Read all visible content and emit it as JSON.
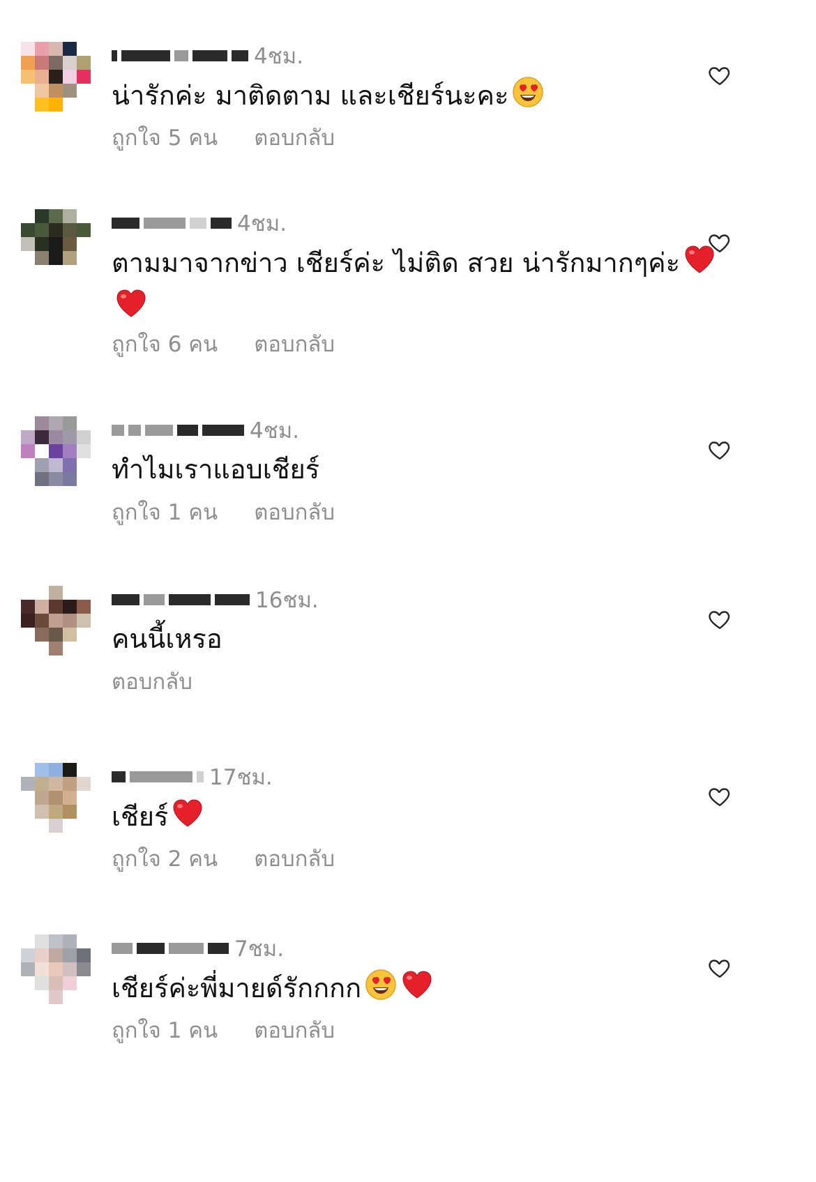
{
  "comments": [
    {
      "username": "",
      "time": "4ชม.",
      "text": "น่ารักค่ะ มาติดตาม และเชียร์นะคะ",
      "emojis": [
        "heart-eyes-emoji"
      ],
      "likes": "ถูกใจ 5 คน",
      "reply": "ตอบกลับ",
      "avatar_colors": [
        "#f6e3ea",
        "#e9a0a8",
        "#d7b8b0",
        "#1b2a44",
        "#ffffff",
        "#f0a050",
        "#c87a78",
        "#7e6a64",
        "#d7d0cc",
        "#b0a070",
        "#f5c070",
        "#e8b090",
        "#2a1f1a",
        "#f0d0e0",
        "#e83060",
        "#ffffff",
        "#f0c8a0",
        "#c09060",
        "#a09080",
        "#ffffff",
        "#ffffff",
        "#ffc020",
        "#ffb000",
        "#ffffff",
        "#ffffff"
      ]
    },
    {
      "username": "",
      "time": "4ชม.",
      "text": "ตามมาจากข่าว เชียร์ค่ะ ไม่ติด สวย น่ารักมากๆค่ะ",
      "emojis": [
        "red-heart-emoji",
        "red-heart-emoji"
      ],
      "likes": "ถูกใจ 6 คน",
      "reply": "ตอบกลับ",
      "avatar_colors": [
        "#ffffff",
        "#2a3a2a",
        "#5a6a4a",
        "#b0b0a0",
        "#ffffff",
        "#3a4a30",
        "#4a5a3a",
        "#2a2a20",
        "#5a5a40",
        "#4a5a3a",
        "#c0c0b8",
        "#2a3020",
        "#1a1a18",
        "#6a5a40",
        "#ffffff",
        "#ffffff",
        "#8a8070",
        "#1a1a18",
        "#b0a080",
        "#ffffff",
        "#ffffff",
        "#ffffff",
        "#ffffff",
        "#ffffff",
        "#ffffff"
      ]
    },
    {
      "username": "",
      "time": "4ชม.",
      "text": "ทำไมเราแอบเชียร์",
      "emojis": [],
      "likes": "ถูกใจ 1 คน",
      "reply": "ตอบกลับ",
      "avatar_colors": [
        "#ffffff",
        "#9a8a9a",
        "#b0a8b0",
        "#9a9a9a",
        "#ffffff",
        "#c0a8c8",
        "#3a2a3a",
        "#9a8aa0",
        "#a09aa8",
        "#d0d0d0",
        "#c080c0",
        "#ffffff",
        "#6a40a0",
        "#a080c0",
        "#e0e0e0",
        "#ffffff",
        "#a0a0b0",
        "#c0b8d0",
        "#8070b0",
        "#ffffff",
        "#ffffff",
        "#707080",
        "#8a8aa0",
        "#7a7aa0",
        "#ffffff"
      ]
    },
    {
      "username": "",
      "time": "16ชม.",
      "text": "คนนี้เหรอ",
      "emojis": [],
      "likes": "",
      "reply": "ตอบกลับ",
      "avatar_colors": [
        "#ffffff",
        "#ffffff",
        "#c0b0a0",
        "#ffffff",
        "#ffffff",
        "#4a2a2a",
        "#d0b0a0",
        "#5a3a30",
        "#2a1a18",
        "#8a5a4a",
        "#3a2020",
        "#6a4a3a",
        "#c0a090",
        "#b09080",
        "#d0c0b0",
        "#ffffff",
        "#8a6a5a",
        "#6a5a4a",
        "#d0c0a0",
        "#ffffff",
        "#ffffff",
        "#ffffff",
        "#a08070",
        "#ffffff",
        "#ffffff"
      ]
    },
    {
      "username": "",
      "time": "17ชม.",
      "text": "เชียร์",
      "emojis": [
        "red-heart-emoji"
      ],
      "likes": "ถูกใจ 2 คน",
      "reply": "ตอบกลับ",
      "avatar_colors": [
        "#ffffff",
        "#a0c0e8",
        "#90b0e0",
        "#1a1a18",
        "#ffffff",
        "#b0b0b8",
        "#c0b090",
        "#d0b8a0",
        "#c0a080",
        "#e0d8d0",
        "#ffffff",
        "#c0a890",
        "#b09070",
        "#d0b090",
        "#ffffff",
        "#ffffff",
        "#d0c0b0",
        "#c0a880",
        "#b09060",
        "#ffffff",
        "#ffffff",
        "#ffffff",
        "#d8d0d0",
        "#ffffff",
        "#ffffff"
      ]
    },
    {
      "username": "",
      "time": "7ชม.",
      "text": "เชียร์ค่ะพี่มายด์รักกกก",
      "emojis": [
        "heart-eyes-emoji",
        "red-heart-emoji"
      ],
      "likes": "ถูกใจ 1 คน",
      "reply": "ตอบกลับ",
      "avatar_colors": [
        "#ffffff",
        "#e0e0e0",
        "#c0c0c8",
        "#b0b0b8",
        "#ffffff",
        "#d0d0d8",
        "#e8d0c8",
        "#c0a8a0",
        "#a0a0a8",
        "#707078",
        "#b0b0b8",
        "#f0e0d8",
        "#e8c8b8",
        "#d0c0c0",
        "#8a8a90",
        "#ffffff",
        "#e0e0e0",
        "#d8c0b8",
        "#f0d0d8",
        "#ffffff",
        "#ffffff",
        "#ffffff",
        "#e0c8c8",
        "#ffffff",
        "#ffffff"
      ]
    }
  ],
  "heart_icon_color": "#262626",
  "secondary_text_color": "#8e8e8e"
}
